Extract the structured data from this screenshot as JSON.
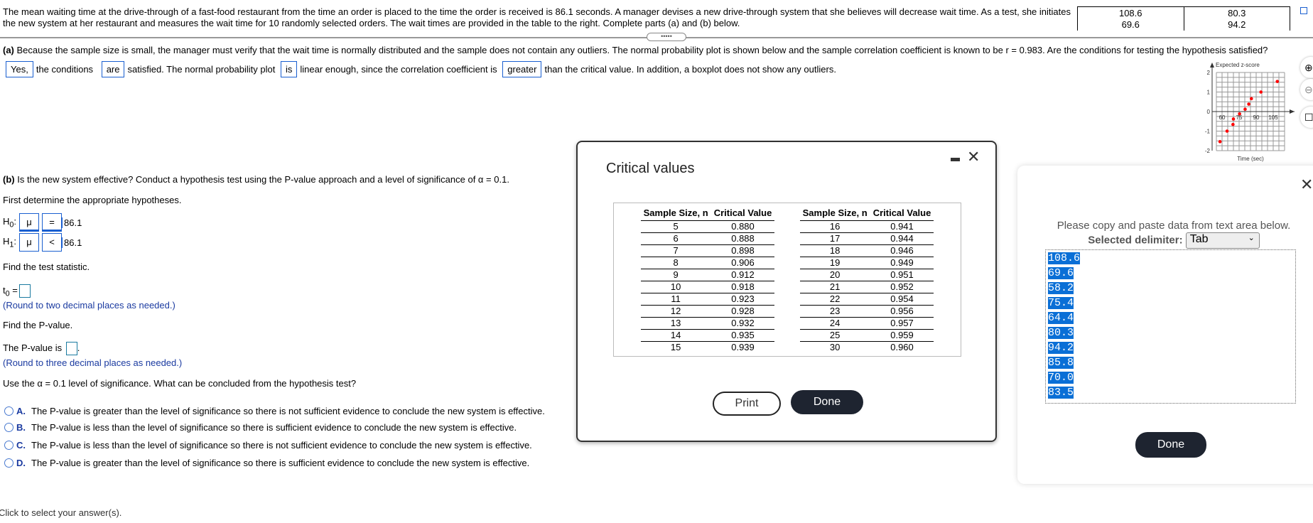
{
  "problem": {
    "intro_line1": "The mean waiting time at the drive-through of a fast-food restaurant from the time an order is placed to the time the order is received is 86.1 seconds. A manager devises a new drive-through system that she believes will decrease wait time. As a test, she initiates",
    "intro_line2": "the new system at her restaurant and measures the wait time for 10 randomly selected orders. The wait times are provided in the table to the right. Complete parts (a) and (b) below.",
    "data_table": [
      [
        "108.6",
        "69.6"
      ],
      [
        "80.3",
        "94.2"
      ]
    ],
    "handle": "•••••"
  },
  "part_a": {
    "label": "(a)",
    "question": "Because the sample size is small, the manager must verify that the wait time is normally distributed and the sample does not contain any outliers. The normal probability plot is shown below and the sample correlation coefficient is known to be r = 0.983. Are the conditions for testing the hypothesis satisfied?",
    "answer": {
      "box1": "Yes,",
      "t1": "the conditions",
      "box2": "are",
      "t2": "satisfied. The normal probability plot",
      "box3": "is",
      "t3": "linear enough, since the correlation coefficient is",
      "box4": "greater",
      "t4": "than the critical value. In addition, a boxplot does not show any outliers."
    }
  },
  "chart_data": {
    "type": "scatter",
    "ylabel": "Expected z-score",
    "xlabel": "Time (sec)",
    "xticks": [
      "60",
      "75",
      "90",
      "105"
    ],
    "yticks": [
      "2",
      "1",
      "0",
      "-1",
      "-2"
    ],
    "xlim": [
      55,
      115
    ],
    "ylim": [
      -2,
      2
    ],
    "grid": true,
    "point_color": "#ff0000",
    "points": [
      [
        58.2,
        -1.54
      ],
      [
        64.4,
        -1.0
      ],
      [
        69.6,
        -0.66
      ],
      [
        70.0,
        -0.38
      ],
      [
        75.4,
        -0.12
      ],
      [
        80.3,
        0.12
      ],
      [
        83.5,
        0.38
      ],
      [
        85.8,
        0.66
      ],
      [
        94.2,
        1.0
      ],
      [
        108.6,
        1.54
      ]
    ]
  },
  "part_b": {
    "label": "(b)",
    "question": "Is the new system effective? Conduct a hypothesis test using the P-value approach and a level of significance of α = 0.1.",
    "hyp_prompt": "First determine the appropriate hypotheses.",
    "h0": {
      "label": "H",
      "sub": "0",
      "param": "μ",
      "op": "=",
      "value": "86.1"
    },
    "h1": {
      "label": "H",
      "sub": "1",
      "param": "μ",
      "op": "<",
      "value": "86.1"
    },
    "stat_prompt": "Find the test statistic.",
    "t_label": "t",
    "t_sub": "0",
    "t_eq": "=",
    "round2": "(Round to two decimal places as needed.)",
    "p_prompt": "Find the P-value.",
    "p_label": "The P-value is",
    "round3": "(Round to three decimal places as needed.)",
    "conclude_prompt": "Use the α = 0.1 level of significance. What can be concluded from the hypothesis test?",
    "choices": [
      {
        "letter": "A.",
        "text": "The P-value is greater than the level of significance so there is not sufficient evidence to conclude the new system is effective."
      },
      {
        "letter": "B.",
        "text": "The P-value is less than the level of significance so there is sufficient evidence to conclude the new system is effective."
      },
      {
        "letter": "C.",
        "text": "The P-value is less than the level of significance so there is not sufficient evidence to conclude the new system is effective."
      },
      {
        "letter": "D.",
        "text": "The P-value is greater than the level of significance so there is sufficient evidence to conclude the new system is effective."
      }
    ]
  },
  "footer": "Click to select your answer(s).",
  "critical_dialog": {
    "title": "Critical values",
    "headers": [
      "Sample Size, n",
      "Critical Value"
    ],
    "left": [
      [
        "5",
        "0.880"
      ],
      [
        "6",
        "0.888"
      ],
      [
        "7",
        "0.898"
      ],
      [
        "8",
        "0.906"
      ],
      [
        "9",
        "0.912"
      ],
      [
        "10",
        "0.918"
      ],
      [
        "11",
        "0.923"
      ],
      [
        "12",
        "0.928"
      ],
      [
        "13",
        "0.932"
      ],
      [
        "14",
        "0.935"
      ],
      [
        "15",
        "0.939"
      ]
    ],
    "right": [
      [
        "16",
        "0.941"
      ],
      [
        "17",
        "0.944"
      ],
      [
        "18",
        "0.946"
      ],
      [
        "19",
        "0.949"
      ],
      [
        "20",
        "0.951"
      ],
      [
        "21",
        "0.952"
      ],
      [
        "22",
        "0.954"
      ],
      [
        "23",
        "0.956"
      ],
      [
        "24",
        "0.957"
      ],
      [
        "25",
        "0.959"
      ],
      [
        "30",
        "0.960"
      ]
    ],
    "print": "Print",
    "done": "Done"
  },
  "data_dialog": {
    "instruction": "Please copy and paste data from text area below.",
    "delimiter_label": "Selected delimiter:",
    "delimiter_value": "Tab",
    "values": [
      "108.6",
      "69.6",
      "58.2",
      "75.4",
      "64.4",
      "80.3",
      "94.2",
      "85.8",
      "70.0",
      "83.5"
    ],
    "done": "Done"
  }
}
